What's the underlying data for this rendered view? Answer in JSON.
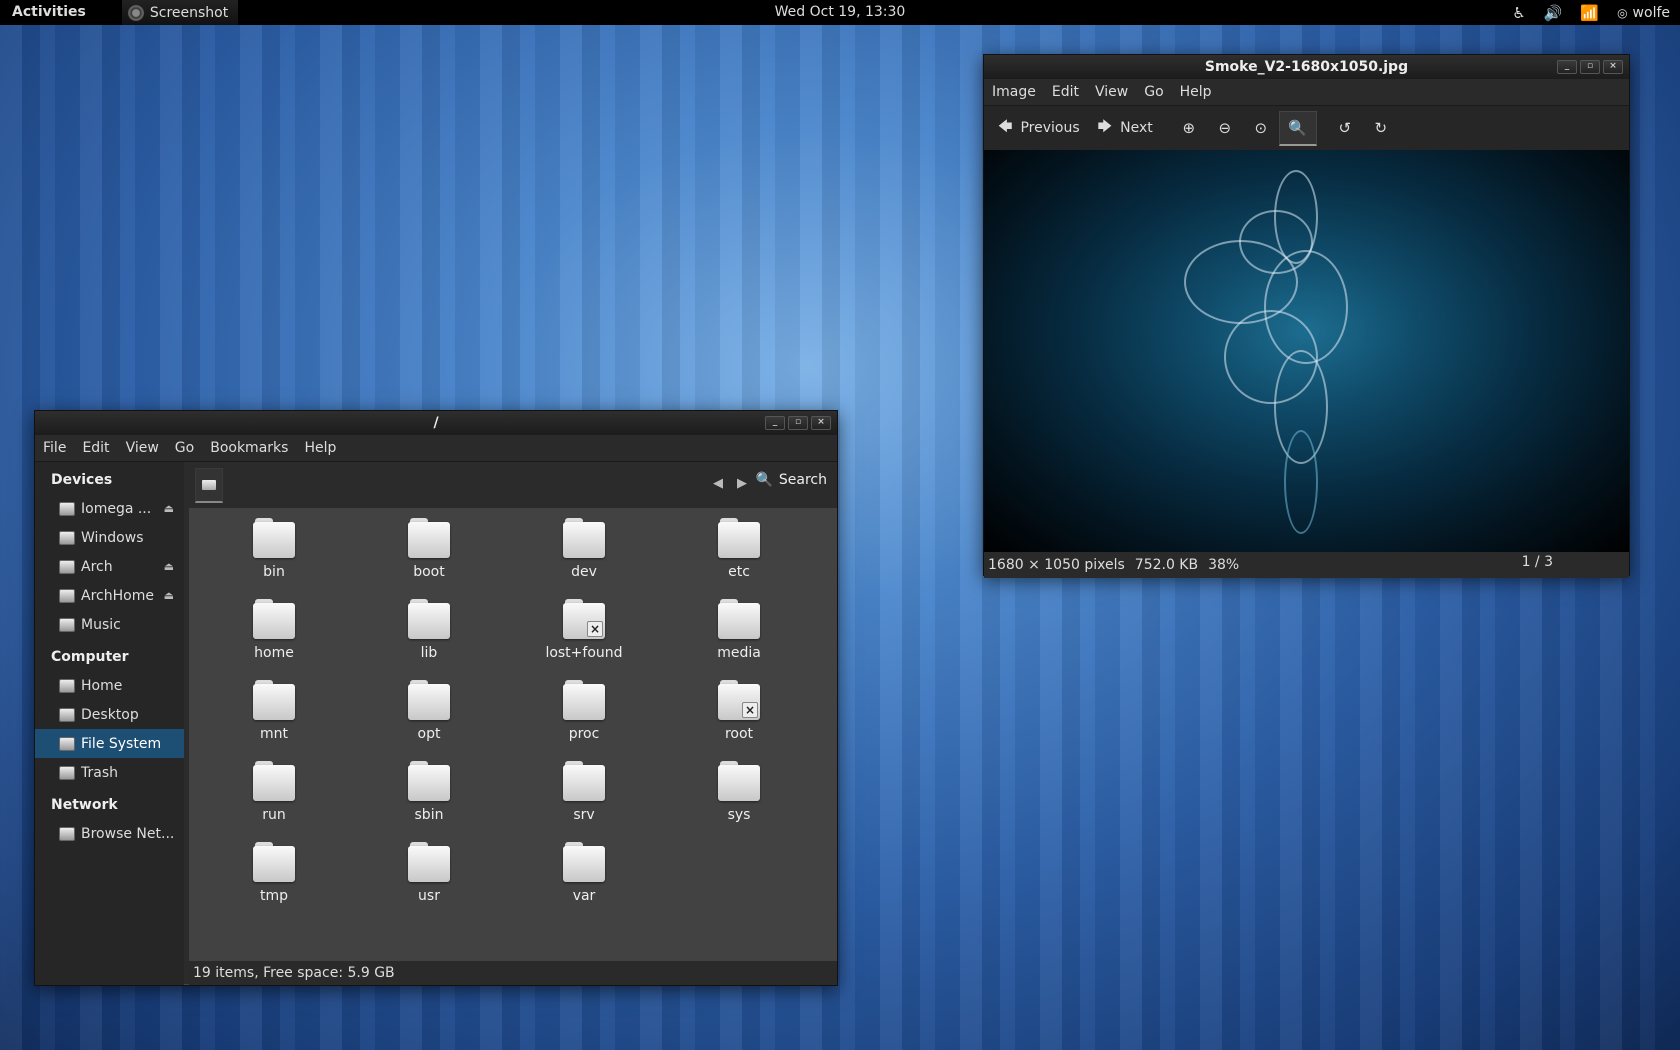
{
  "topbar": {
    "activities": "Activities",
    "app_name": "Screenshot",
    "clock": "Wed Oct 19, 13:30",
    "user": "wolfe"
  },
  "icons": {
    "accessibility": "accessibility-icon",
    "volume": "volume-icon",
    "wifi": "wifi-icon"
  },
  "nautilus": {
    "title": "/",
    "menu": [
      "File",
      "Edit",
      "View",
      "Go",
      "Bookmarks",
      "Help"
    ],
    "sidebar": {
      "devices_label": "Devices",
      "devices": [
        "Iomega ...",
        "Windows",
        "Arch",
        "ArchHome",
        "Music"
      ],
      "computer_label": "Computer",
      "computer": [
        "Home",
        "Desktop",
        "File System",
        "Trash"
      ],
      "network_label": "Network",
      "network": [
        "Browse Net..."
      ]
    },
    "search_label": "Search",
    "files": [
      "bin",
      "boot",
      "dev",
      "etc",
      "home",
      "lib",
      "lost+found",
      "media",
      "mnt",
      "opt",
      "proc",
      "root",
      "run",
      "sbin",
      "srv",
      "sys",
      "tmp",
      "usr",
      "var"
    ],
    "status": "19 items, Free space: 5.9 GB"
  },
  "eog": {
    "title": "Smoke_V2-1680x1050.jpg",
    "menu": [
      "Image",
      "Edit",
      "View",
      "Go",
      "Help"
    ],
    "previous_label": "Previous",
    "next_label": "Next",
    "dimensions": "1680 × 1050 pixels",
    "size": "752.0 KB",
    "zoom": "38%",
    "count": "1 / 3"
  }
}
